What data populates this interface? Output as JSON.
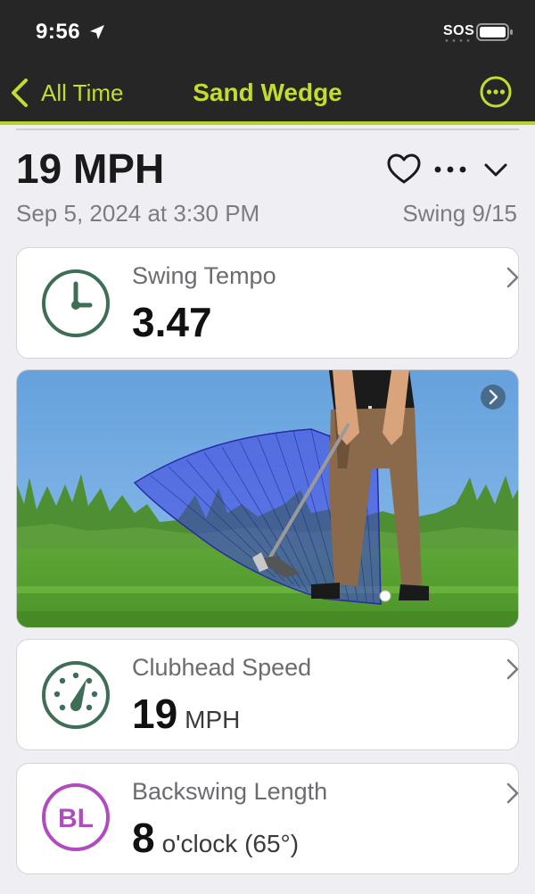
{
  "status_bar": {
    "time": "9:56",
    "sos": "SOS"
  },
  "nav": {
    "back_label": "All Time",
    "title": "Sand Wedge",
    "accent_color": "#c5dc2f"
  },
  "header": {
    "speed": "19 MPH",
    "date": "Sep 5, 2024 at 3:30 PM",
    "swing_counter": "Swing 9/15",
    "icons": [
      "heart-icon",
      "more-dots-icon",
      "chevron-down-icon"
    ]
  },
  "metrics": {
    "tempo": {
      "label": "Swing Tempo",
      "value": "3.47",
      "unit": "",
      "icon": "clock-icon",
      "icon_color": "#3f6d55"
    },
    "clubhead_speed": {
      "label": "Clubhead Speed",
      "value": "19",
      "unit": "MPH",
      "icon": "speedometer-icon",
      "icon_color": "#3f6d55"
    },
    "backswing": {
      "label": "Backswing Length",
      "value": "8",
      "unit": "o'clock (65°)",
      "icon": "backswing-length-icon",
      "badge_text": "BL",
      "icon_color": "#b04cbf"
    }
  }
}
